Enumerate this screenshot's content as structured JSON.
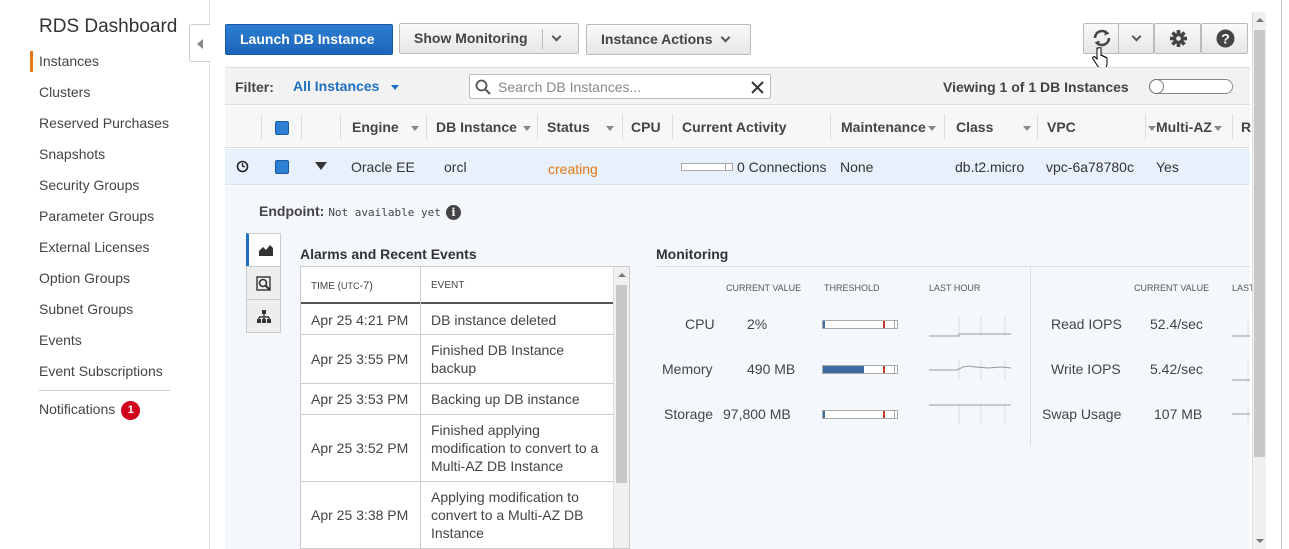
{
  "sidebar": {
    "title": "RDS Dashboard",
    "items": [
      {
        "label": "Instances"
      },
      {
        "label": "Clusters"
      },
      {
        "label": "Reserved Purchases"
      },
      {
        "label": "Snapshots"
      },
      {
        "label": "Security Groups"
      },
      {
        "label": "Parameter Groups"
      },
      {
        "label": "External Licenses"
      },
      {
        "label": "Option Groups"
      },
      {
        "label": "Subnet Groups"
      },
      {
        "label": "Events"
      },
      {
        "label": "Event Subscriptions"
      }
    ],
    "notifications": {
      "label": "Notifications",
      "count": "1"
    }
  },
  "toolbar": {
    "launch_label": "Launch DB Instance",
    "show_monitoring_label": "Show Monitoring",
    "instance_actions_label": "Instance Actions"
  },
  "filter": {
    "label": "Filter:",
    "value": "All Instances",
    "search_placeholder": "Search DB Instances...",
    "viewing": "Viewing 1 of 1 DB Instances"
  },
  "table": {
    "headers": [
      "Engine",
      "DB Instance",
      "Status",
      "CPU",
      "Current Activity",
      "Maintenance",
      "Class",
      "VPC",
      "Multi-AZ",
      "R"
    ],
    "row": {
      "engine": "Oracle EE",
      "db_instance": "orcl",
      "status": "creating",
      "activity": "0 Connections",
      "maintenance": "None",
      "class": "db.t2.micro",
      "vpc": "vpc-6a78780c",
      "multi_az": "Yes"
    }
  },
  "details": {
    "endpoint_label": "Endpoint:",
    "endpoint_value": "Not available yet"
  },
  "alarms": {
    "title": "Alarms and Recent Events",
    "time_header_prefix": "TIME (",
    "time_header_tz": "UTC",
    "time_header_suffix": "-7)",
    "event_header": "EVENT",
    "rows": [
      {
        "time": "Apr 25 4:21 PM",
        "event": "DB instance deleted"
      },
      {
        "time": "Apr 25 3:55 PM",
        "event": "Finished DB Instance backup"
      },
      {
        "time": "Apr 25 3:53 PM",
        "event": "Backing up DB instance"
      },
      {
        "time": "Apr 25 3:52 PM",
        "event": "Finished applying modification to convert to a Multi-AZ DB Instance"
      },
      {
        "time": "Apr 25 3:38 PM",
        "event": "Applying modification to convert to a Multi-AZ DB Instance"
      }
    ]
  },
  "monitoring": {
    "title": "Monitoring",
    "col_current": "CURRENT VALUE",
    "col_threshold": "THRESHOLD",
    "col_last_hour": "LAST HOUR",
    "col_last_partial": "LAST",
    "left_metrics": [
      {
        "name": "CPU",
        "value": "2%",
        "threshold_fill": 0.02
      },
      {
        "name": "Memory",
        "value": "490 MB",
        "threshold_fill": 0.55
      },
      {
        "name": "Storage",
        "value": "97,800 MB",
        "threshold_fill": 0.03
      }
    ],
    "right_metrics": [
      {
        "name": "Read IOPS",
        "value": "52.4/sec"
      },
      {
        "name": "Write IOPS",
        "value": "5.42/sec"
      },
      {
        "name": "Swap Usage",
        "value": "107 MB"
      }
    ]
  },
  "colors": {
    "accent": "#1e6fc3",
    "primary_button": "#2d7fd3",
    "status_creating": "#e47911",
    "badge": "#d0021b"
  }
}
